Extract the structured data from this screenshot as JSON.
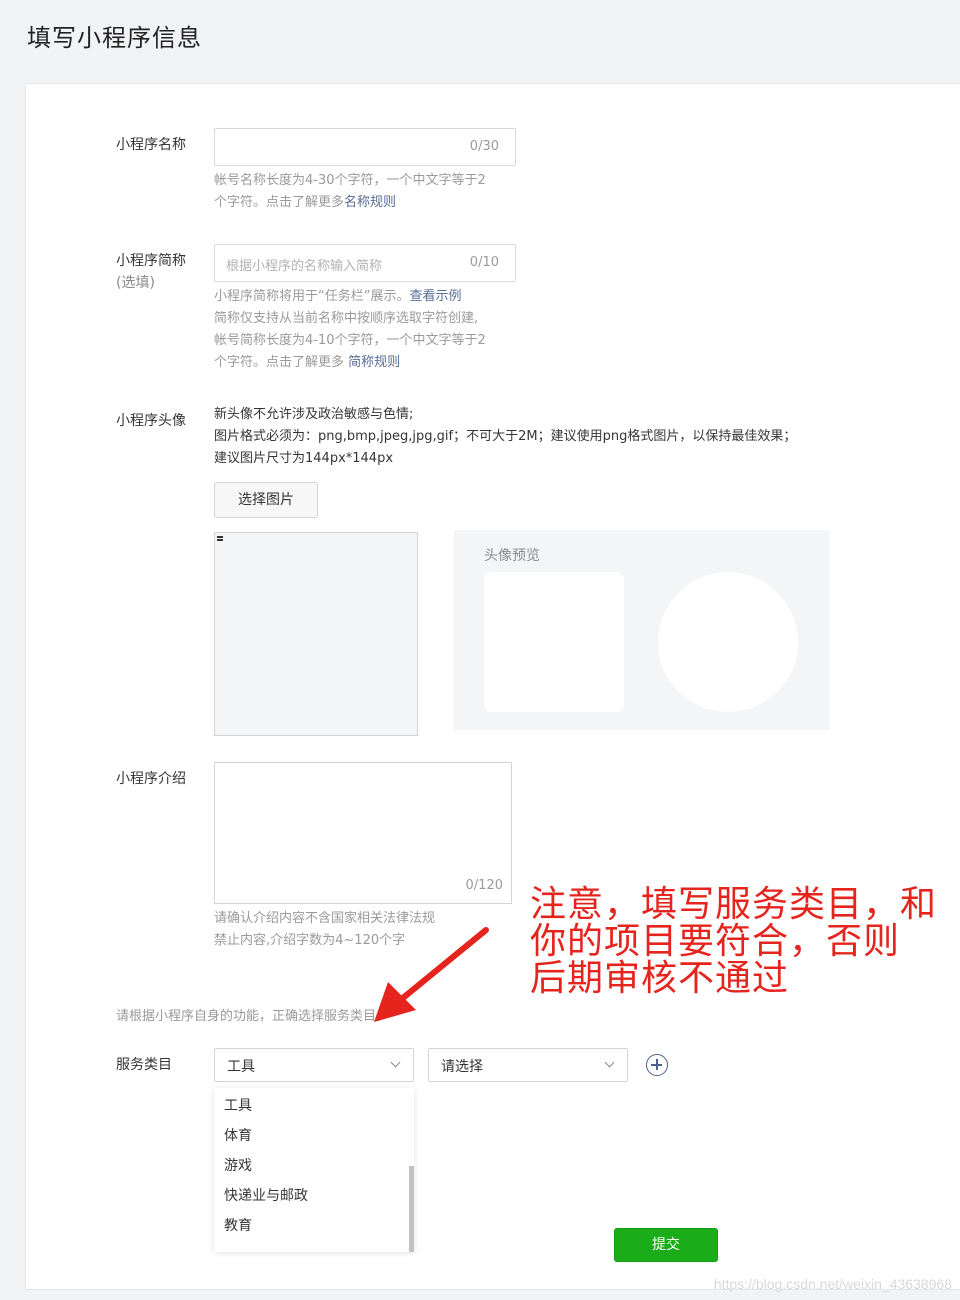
{
  "page_title": "填写小程序信息",
  "name": {
    "label": "小程序名称",
    "counter": "0/30",
    "tip_line1": "帐号名称长度为4-30个字符，一个中文字等于2",
    "tip_line2_prefix": "个字符。点击了解更多",
    "tip_link": "名称规则"
  },
  "short_name": {
    "label": "小程序简称",
    "optional": "(选填)",
    "placeholder": "根据小程序的名称输入简称",
    "counter": "0/10",
    "tip_line1_prefix": "小程序简称将用于“任务栏”展示。",
    "tip_line1_link": "查看示例",
    "tip_line2": "简称仅支持从当前名称中按顺序选取字符创建,",
    "tip_line3": "帐号简称长度为4-10个字符，一个中文字等于2",
    "tip_line4_prefix": "个字符。点击了解更多 ",
    "tip_line4_link": "简称规则"
  },
  "avatar": {
    "label": "小程序头像",
    "rule1": "新头像不允许涉及政治敏感与色情;",
    "rule2": "图片格式必须为：png,bmp,jpeg,jpg,gif；不可大于2M；建议使用png格式图片，以保持最佳效果；",
    "rule3": "建议图片尺寸为144px*144px",
    "select_button": "选择图片",
    "preview_title": "头像预览"
  },
  "intro": {
    "label": "小程序介绍",
    "counter": "0/120",
    "tip_line1": "请确认介绍内容不含国家相关法律法规",
    "tip_line2": "禁止内容,介绍字数为4~120个字"
  },
  "category": {
    "hint": "请根据小程序自身的功能，正确选择服务类目。",
    "label": "服务类目",
    "primary_value": "工具",
    "secondary_value": "请选择",
    "options": [
      "工具",
      "体育",
      "游戏",
      "快递业与邮政",
      "教育"
    ]
  },
  "submit_label": "提交",
  "annotation": {
    "line1": "注意，填写服务类目，和",
    "line2": "你的项目要符合，否则",
    "line3": "后期审核不通过",
    "color": "#e5251d"
  },
  "watermark": "https://blog.csdn.net/weixin_43638968",
  "colors": {
    "link": "#576b95",
    "submit": "#1aad19",
    "icon_blue": "#4a5f8c"
  }
}
